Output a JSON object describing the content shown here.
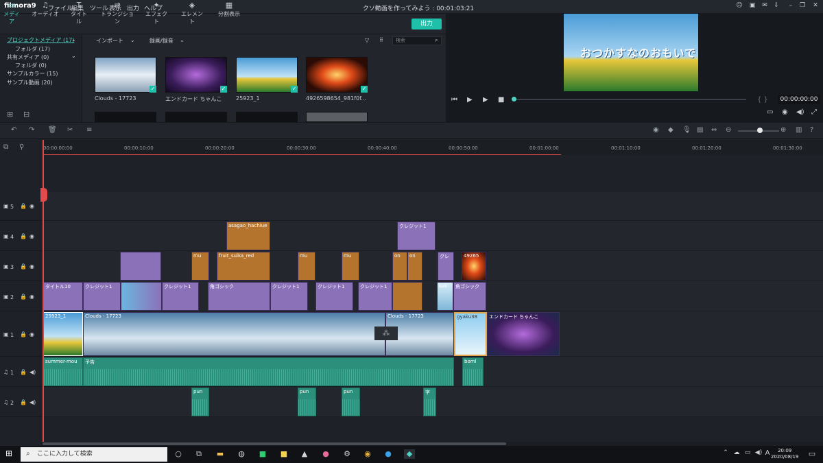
{
  "app": {
    "name": "filmora9",
    "title": "クソ動画を作ってみよう : 00:01:03:21"
  },
  "menu": [
    "ファイル",
    "編集",
    "ツール",
    "表示",
    "出力",
    "ヘルプ"
  ],
  "tabs": [
    {
      "label": "メディア",
      "icon": "folder-icon"
    },
    {
      "label": "オーディオ",
      "icon": "music-icon"
    },
    {
      "label": "タイトル",
      "icon": "text-icon"
    },
    {
      "label": "トランジション",
      "icon": "transition-icon"
    },
    {
      "label": "エフェクト",
      "icon": "effect-icon"
    },
    {
      "label": "エレメント",
      "icon": "element-icon"
    },
    {
      "label": "分割表示",
      "icon": "split-icon"
    }
  ],
  "export_label": "出力",
  "library": {
    "items": [
      {
        "label": "プロジェクトメディア (17)",
        "selected": true
      },
      {
        "label": "フォルダ (17)"
      },
      {
        "label": "共有メディア (0)"
      },
      {
        "label": "フォルダ (0)"
      },
      {
        "label": "サンプルカラー (15)"
      },
      {
        "label": "サンプル動画 (20)"
      }
    ]
  },
  "mediabar": {
    "import": "インポート",
    "record": "録画/録音",
    "search_placeholder": "検索"
  },
  "media": [
    {
      "label": "Clouds - 17723"
    },
    {
      "label": "エンドカード ちゃんこ"
    },
    {
      "label": "25923_1"
    },
    {
      "label": "4926598654_981f0f..."
    }
  ],
  "preview": {
    "overlay_text": "おつかすなのおもいで",
    "timecode": "00:00:00:00"
  },
  "ruler": [
    "00:00:00:00",
    "00:00:10:00",
    "00:00:20:00",
    "00:00:30:00",
    "00:00:40:00",
    "00:00:50:00",
    "00:01:00:00",
    "00:01:10:00",
    "00:01:20:00",
    "00:01:30:00"
  ],
  "tracks": {
    "v5": "5",
    "v4": "4",
    "v3": "3",
    "v2": "2",
    "v1": "1",
    "a1": "1",
    "a2": "2"
  },
  "clips": {
    "v4": [
      "asagao_hachiue",
      "クレジット1"
    ],
    "v3": [
      "mu",
      "fruit_suika_red",
      "mu",
      "mu",
      "on",
      "on",
      "クレ",
      "49265"
    ],
    "v2": [
      "タイトル10",
      "クレジット1",
      "クレジット1",
      "角ゴシック",
      "クレジット1",
      "クレジット1",
      "クレジット1",
      "kak",
      "角ゴシック"
    ],
    "v1": [
      "25923_1",
      "Clouds - 17723",
      "Clouds - 17723",
      "gyaku38",
      "エンドカード ちゃんこ"
    ],
    "a1": [
      "summer-mou",
      "予告",
      "boml"
    ],
    "a2": [
      "pun",
      "pun",
      "pun",
      "字"
    ]
  },
  "taskbar": {
    "search": "ここに入力して検索",
    "time": "20:09",
    "date": "2020/08/19",
    "ime": "A"
  }
}
